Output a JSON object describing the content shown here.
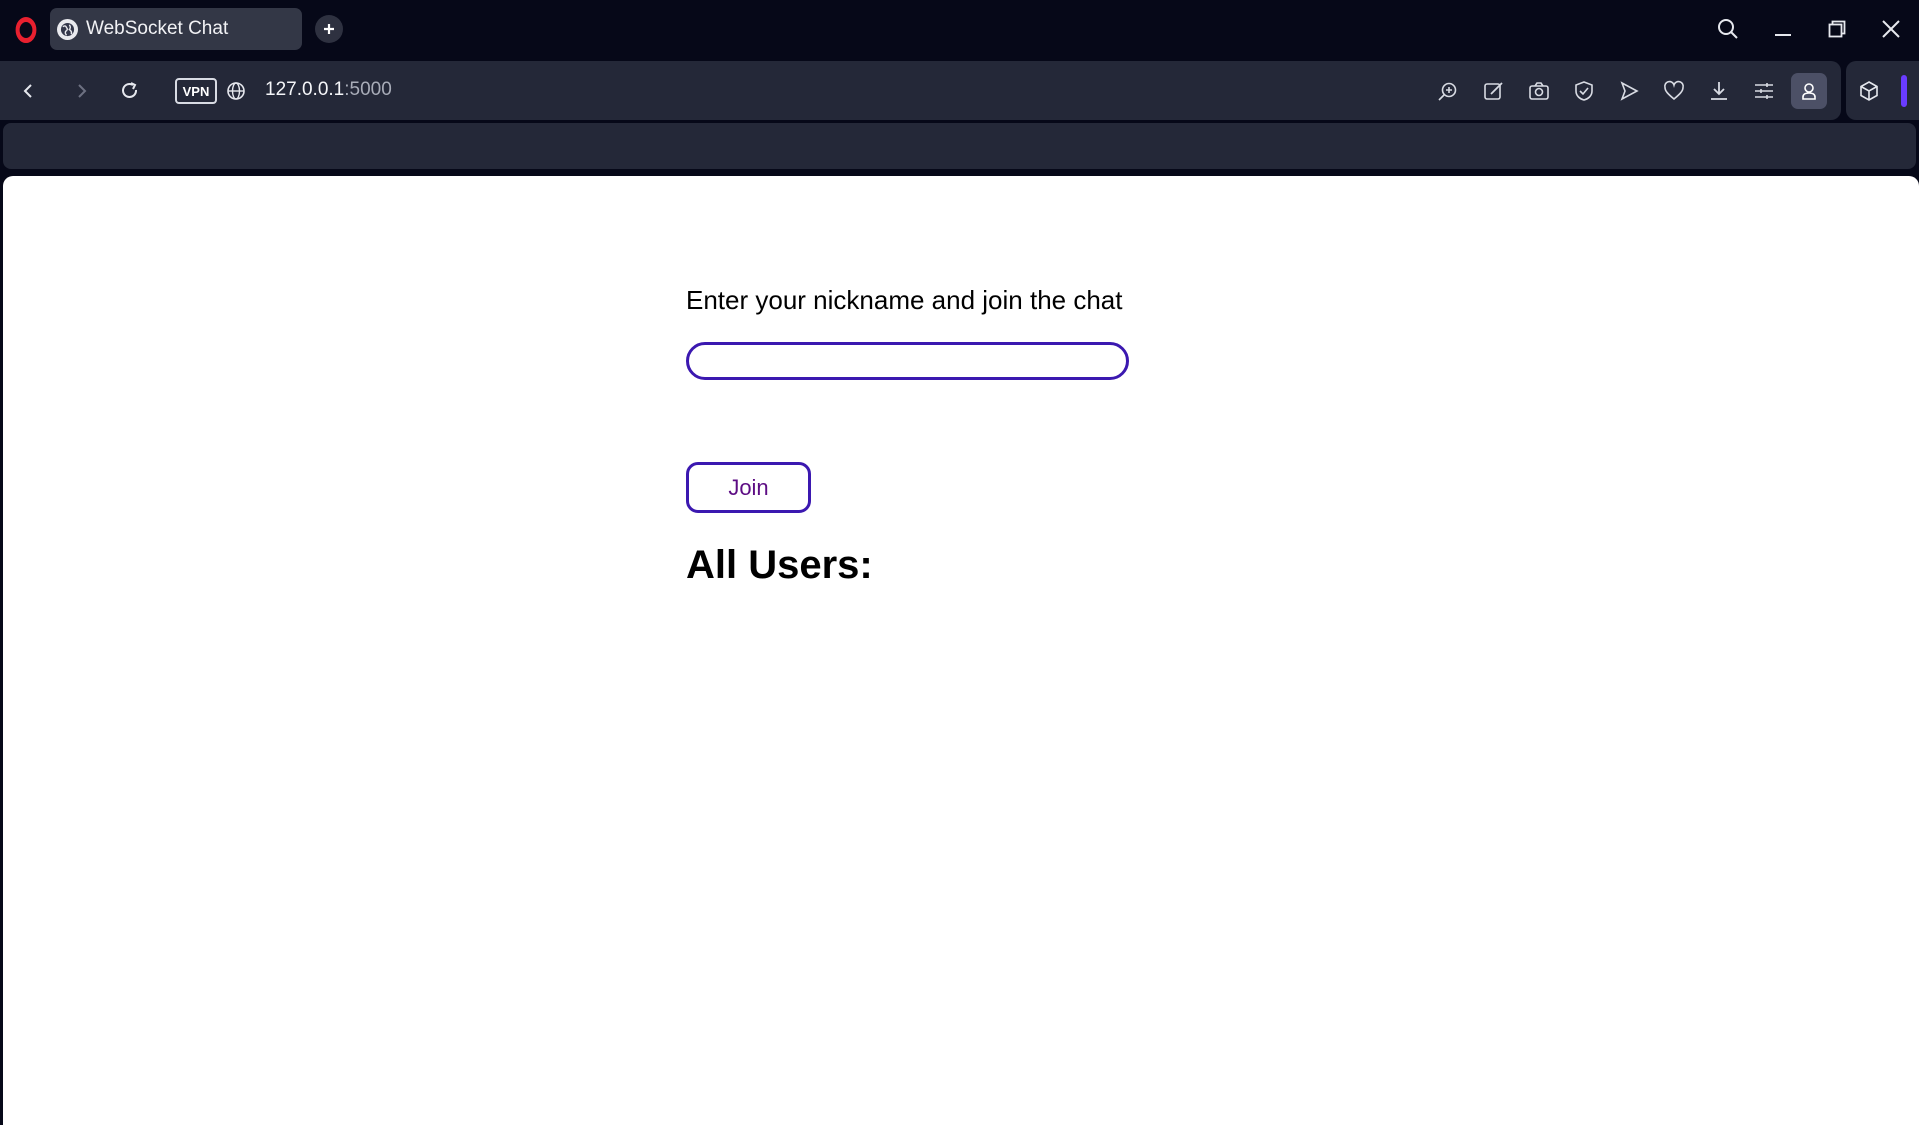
{
  "browser": {
    "tab_title": "WebSocket Chat",
    "vpn_label": "VPN",
    "url_host": "127.0.0.1",
    "url_port": ":5000",
    "accent_color": "#6a3cff",
    "logo_color": "#e8202f"
  },
  "page": {
    "prompt": "Enter your nickname and join the chat",
    "nickname_value": "",
    "join_label": "Join",
    "users_heading": "All Users:",
    "accent_color": "#3b18b0",
    "button_text_color": "#5d0d84"
  },
  "icons": {
    "tab_favicon": "globe-icon",
    "new_tab": "plus-icon",
    "search": "search-icon",
    "back": "chevron-left-icon",
    "forward": "chevron-right-icon",
    "reload": "reload-icon",
    "site_info": "globe-icon",
    "toolbar": [
      "zoom-icon",
      "edit-icon",
      "camera-icon",
      "shield-icon",
      "send-icon",
      "heart-icon",
      "download-icon",
      "menu-icon",
      "profile-icon",
      "cube-icon"
    ]
  }
}
